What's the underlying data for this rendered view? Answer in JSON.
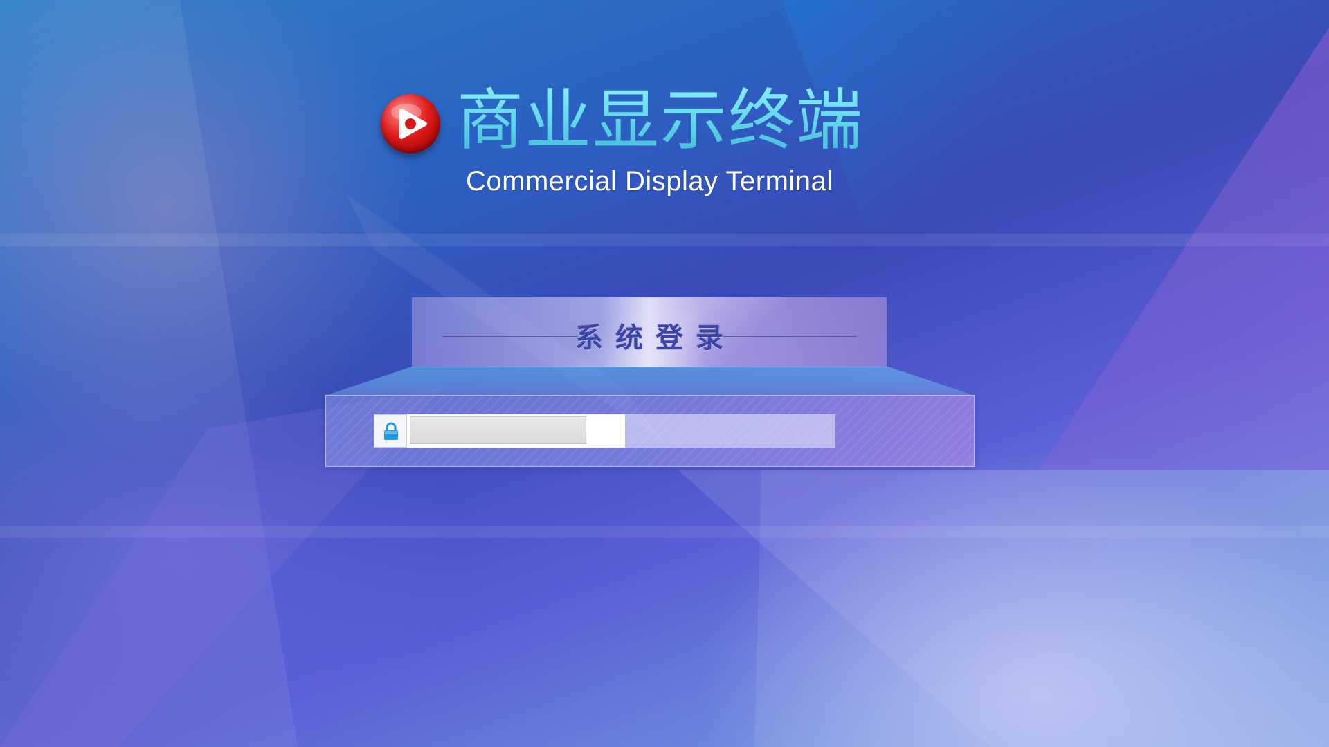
{
  "app": {
    "title_cn": "商业显示终端",
    "title_en": "Commercial Display Terminal",
    "logo_icon": "play-icon"
  },
  "login": {
    "header_title": "系统登录",
    "lock_icon": "lock-icon",
    "password": {
      "value": "",
      "placeholder": ""
    }
  },
  "colors": {
    "title_cn": "#5fd3e6",
    "login_title": "#3b45a8",
    "logo_red": "#e01c1c",
    "lock_blue": "#1e9be0"
  }
}
